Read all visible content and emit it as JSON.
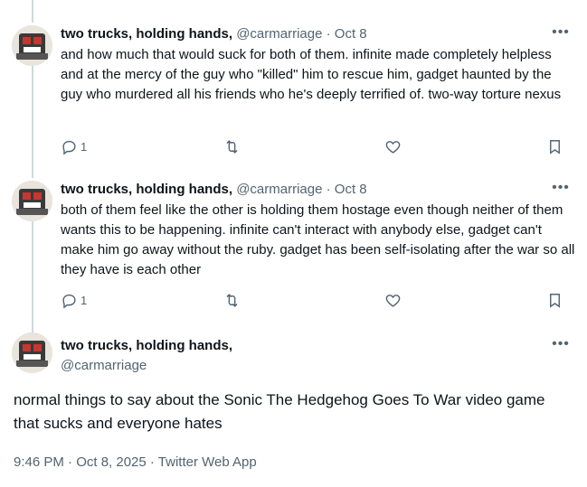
{
  "replies": [
    {
      "name": "two trucks, holding hands,",
      "handle": "@carmarriage",
      "sep": "·",
      "date": "Oct 8",
      "text": "and how much that would suck for both of them. infinite made completely helpless and at the mercy of the guy who \"killed\" him to rescue him, gadget haunted by the guy who murdered all his friends who he's deeply terrified of. two-way torture nexus",
      "reply_count": "1"
    },
    {
      "name": "two trucks, holding hands,",
      "handle": "@carmarriage",
      "sep": "·",
      "date": "Oct 8",
      "text": "both of them feel like the other is holding them hostage even though neither of them wants this to be happening. infinite can't interact with anybody else, gadget can't make him go away without the ruby. gadget has been self-isolating after the war so all they have is each other",
      "reply_count": "1"
    }
  ],
  "main": {
    "name": "two trucks, holding hands,",
    "handle": "@carmarriage",
    "text": "normal things to say about the Sonic The Hedgehog Goes To War video game that sucks and everyone hates",
    "meta": "9:46 PM · Oct 8, 2025 · Twitter Web App"
  },
  "icons": {
    "reply": "reply-icon",
    "retweet": "retweet-icon",
    "like": "heart-icon",
    "bookmark": "bookmark-icon",
    "more": "more-icon"
  },
  "colors": {
    "text": "#0f1419",
    "muted": "#536471",
    "thread_line": "#cfd9de"
  }
}
